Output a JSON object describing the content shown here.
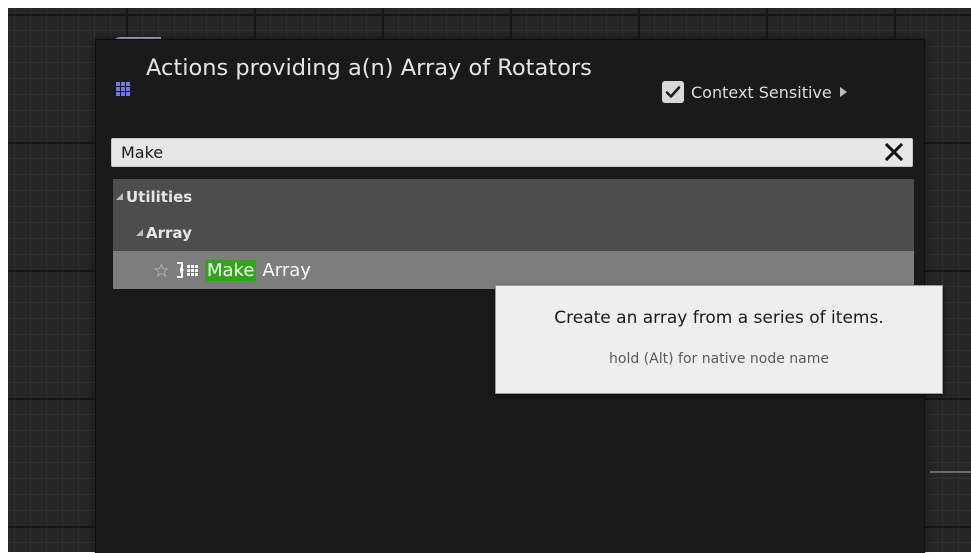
{
  "menu": {
    "title": "Actions providing a(n) Array of Rotators",
    "context_toggle": {
      "label": "Context Sensitive",
      "checked": true
    }
  },
  "search": {
    "value": "Make",
    "placeholder": ""
  },
  "tree": {
    "categories": [
      {
        "label": "Utilities",
        "subcategories": [
          {
            "label": "Array",
            "items": [
              {
                "match": "Make",
                "rest": "Array"
              }
            ]
          }
        ]
      }
    ]
  },
  "tooltip": {
    "text": "Create an array from a series of items.",
    "hint": "hold (Alt) for native node name"
  },
  "colors": {
    "accent_highlight": "#2fa61a",
    "icon_blue": "#6c79e6",
    "selected_row": "#7d7d7d",
    "category_row": "#4d4d4d"
  }
}
